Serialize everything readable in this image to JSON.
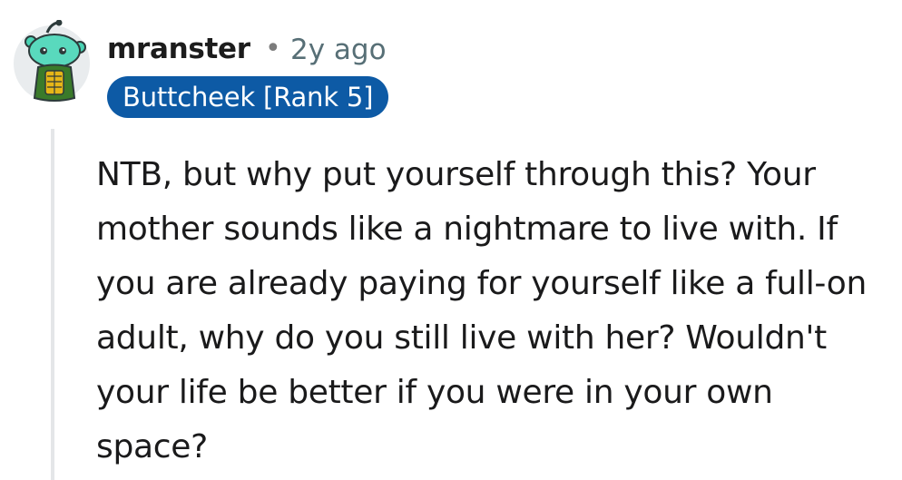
{
  "comment": {
    "author": "mranster",
    "separator": "•",
    "age": "2y ago",
    "flair": "Buttcheek [Rank 5]",
    "body": "NTB, but why put yourself through this? Your mother sounds like a nightmare to live with. If you are already paying for yourself like a full-on adult, why do you still live with her? Wouldn't your life be better if you were in your own space?",
    "avatar_icon": "snoo-avatar-icon"
  },
  "colors": {
    "flair_bg": "#0d5aa5",
    "flair_text": "#ffffff",
    "author_text": "#1c1c1c",
    "meta_text": "#576f76",
    "thread_line": "#e4e6e8",
    "avatar_bg": "#e9ecee",
    "snoo_green": "#49d3b4"
  }
}
